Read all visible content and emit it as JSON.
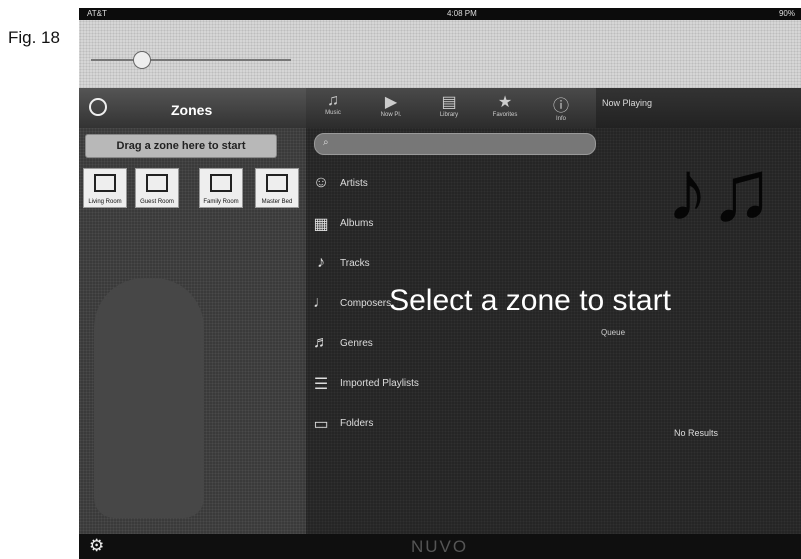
{
  "figure_label": "Fig. 18",
  "status_bar": {
    "carrier": "AT&T",
    "time": "4:08 PM",
    "battery": "90%"
  },
  "left_panel": {
    "title": "Zones",
    "drag_hint": "Drag a zone here to start",
    "zones": [
      {
        "label": "Living Room",
        "icon": "sofa-icon"
      },
      {
        "label": "Guest Room",
        "icon": "bed-icon"
      },
      {
        "label": "Family Room",
        "icon": "window-icon"
      },
      {
        "label": "Master Bed",
        "icon": "bed-icon"
      }
    ]
  },
  "tabs": [
    {
      "label": "Music",
      "icon": "music-icon"
    },
    {
      "label": "Now Pl.",
      "icon": "play-icon"
    },
    {
      "label": "Library",
      "icon": "library-icon"
    },
    {
      "label": "Favorites",
      "icon": "favorites-icon"
    },
    {
      "label": "Info",
      "icon": "info-icon"
    }
  ],
  "now_playing_title": "Now Playing",
  "search": {
    "placeholder": ""
  },
  "library_items": [
    {
      "label": "Artists",
      "icon": "artists-icon"
    },
    {
      "label": "Albums",
      "icon": "albums-icon"
    },
    {
      "label": "Tracks",
      "icon": "tracks-icon"
    },
    {
      "label": "Composers",
      "icon": "composers-icon"
    },
    {
      "label": "Genres",
      "icon": "genres-icon"
    },
    {
      "label": "Imported Playlists",
      "icon": "playlist-icon"
    },
    {
      "label": "Folders",
      "icon": "folder-icon"
    }
  ],
  "overlay_message": "Select a zone to start",
  "queue_label": "Queue",
  "no_results": "No Results",
  "bottom": {
    "brand": "NUVO"
  }
}
